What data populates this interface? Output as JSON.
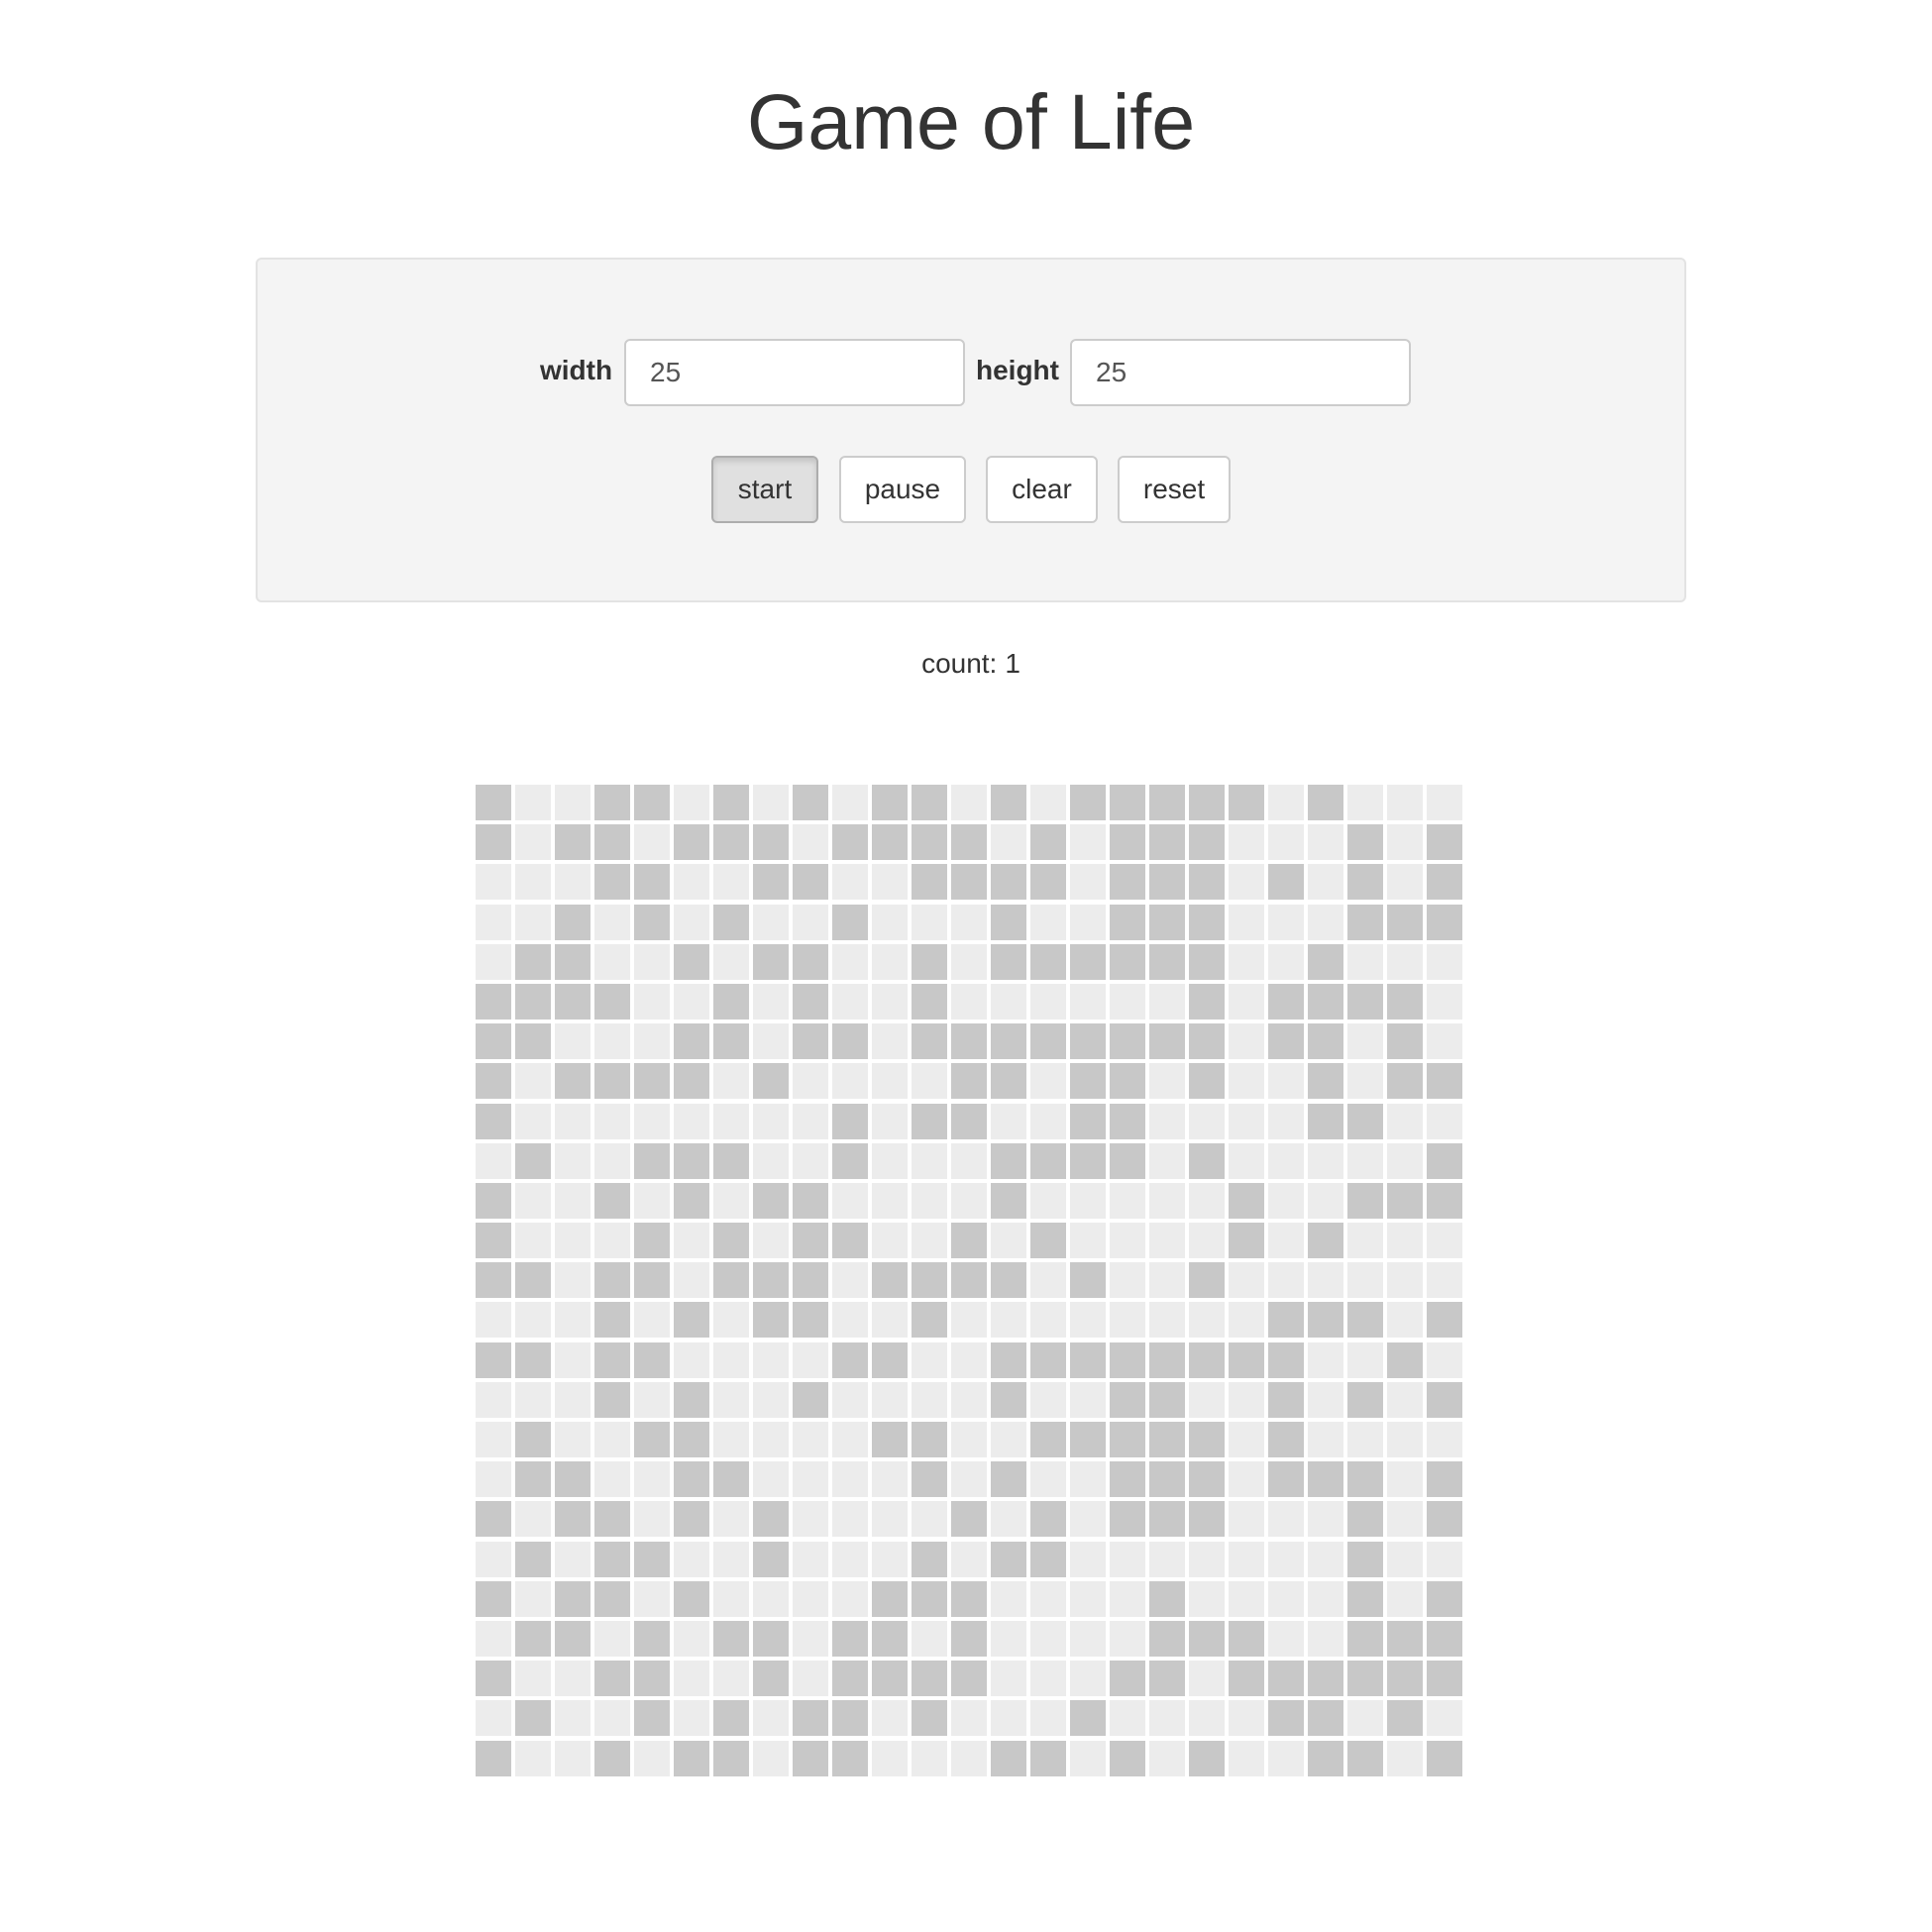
{
  "title": "Game of Life",
  "controls": {
    "width_label": "width",
    "width_value": "25",
    "height_label": "height",
    "height_value": "25",
    "buttons": {
      "start": "start",
      "pause": "pause",
      "clear": "clear",
      "reset": "reset"
    },
    "active_button": "start"
  },
  "count": {
    "label": "count:",
    "value": "1"
  },
  "board": {
    "columns": 25,
    "rows": 25,
    "alive_color": "#c8c8c8",
    "dead_color": "#ececec",
    "cells": [
      "1001101010110101111101000",
      "1011011101111010111000101",
      "0001100110011110111010101",
      "0010101001000100111000111",
      "0110010110010111111001000",
      "1111001010010000001011110",
      "1100011011011111111011010",
      "1011110100001101101001011",
      "1000000001011001100001100",
      "0100111001000111101000001",
      "1001010110000100000100111",
      "1000101011001010000101000",
      "1101101110111101001000000",
      "0001010110010000000011101",
      "1101100001100111111110010",
      "0001010010000100110010101",
      "0100110000110011111010000",
      "0110011000010100111011101",
      "1011010100001010111000101",
      "0101100100010110000000100",
      "1011010000111000010000101",
      "0110101101101000011100111",
      "1001100101111000110111111",
      "0100101011010001000011010",
      "1001011011000110101001101"
    ]
  }
}
